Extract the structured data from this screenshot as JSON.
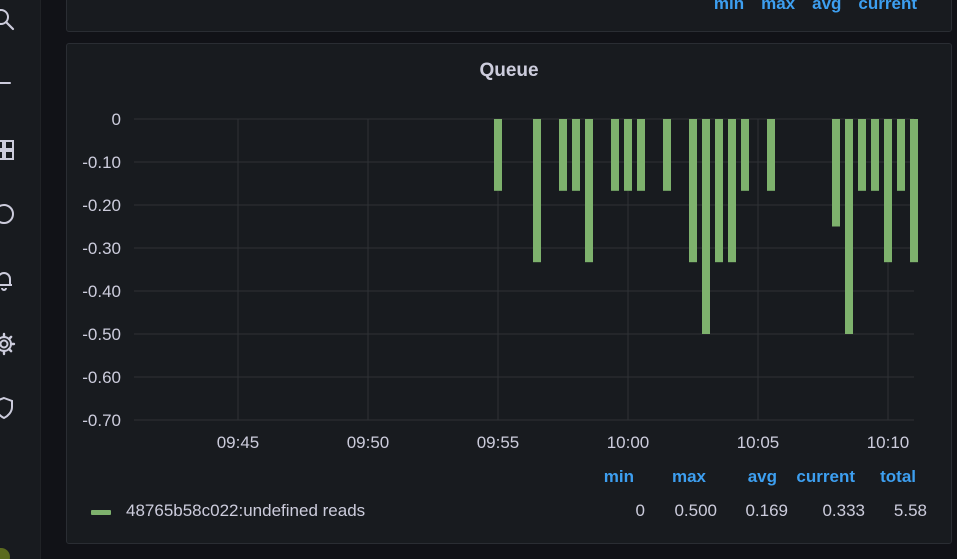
{
  "top_panel": {
    "legend_headers": [
      "min",
      "max",
      "avg",
      "current"
    ]
  },
  "panel": {
    "title": "Queue",
    "legend": {
      "headers": {
        "min": "min",
        "max": "max",
        "avg": "avg",
        "current": "current",
        "total": "total"
      },
      "series_name": "48765b58c022:undefined reads",
      "values": {
        "min": "0",
        "max": "0.500",
        "avg": "0.169",
        "current": "0.333",
        "total": "5.58"
      }
    }
  },
  "colors": {
    "accent": "#3d9ff0",
    "series": "#7eb26d",
    "text": "#ccccdc",
    "grid": "#2f3136"
  },
  "sidebar_icons": [
    "search-icon",
    "minus-icon",
    "dashboards-icon",
    "explore-icon",
    "alerting-icon",
    "settings-icon",
    "shield-icon"
  ],
  "chart_data": {
    "type": "bar",
    "title": "Queue",
    "x_tick_labels": [
      "09:45",
      "09:50",
      "09:55",
      "10:00",
      "10:05",
      "10:10"
    ],
    "y_tick_labels": [
      "0",
      "-0.10",
      "-0.20",
      "-0.30",
      "-0.40",
      "-0.50",
      "-0.60",
      "-0.70"
    ],
    "ylim": [
      -0.7,
      0
    ],
    "xlim": [
      "09:41",
      "10:11"
    ],
    "grid": true,
    "legend_position": "bottom",
    "series": [
      {
        "name": "48765b58c022:undefined reads",
        "color": "#7eb26d",
        "points": [
          {
            "x": "09:55",
            "y": -0.167
          },
          {
            "x": "09:56:30",
            "y": -0.333
          },
          {
            "x": "09:57:30",
            "y": -0.167
          },
          {
            "x": "09:58",
            "y": -0.167
          },
          {
            "x": "09:58:30",
            "y": -0.333
          },
          {
            "x": "09:59:30",
            "y": -0.167
          },
          {
            "x": "10:00",
            "y": -0.167
          },
          {
            "x": "10:00:30",
            "y": -0.167
          },
          {
            "x": "10:01:30",
            "y": -0.167
          },
          {
            "x": "10:02:30",
            "y": -0.333
          },
          {
            "x": "10:03",
            "y": -0.5
          },
          {
            "x": "10:03:30",
            "y": -0.333
          },
          {
            "x": "10:04",
            "y": -0.333
          },
          {
            "x": "10:04:30",
            "y": -0.167
          },
          {
            "x": "10:05:30",
            "y": -0.167
          },
          {
            "x": "10:08",
            "y": -0.25
          },
          {
            "x": "10:08:30",
            "y": -0.5
          },
          {
            "x": "10:09",
            "y": -0.167
          },
          {
            "x": "10:09:30",
            "y": -0.167
          },
          {
            "x": "10:10",
            "y": -0.333
          },
          {
            "x": "10:10:30",
            "y": -0.167
          },
          {
            "x": "10:11",
            "y": -0.333
          }
        ]
      }
    ]
  }
}
